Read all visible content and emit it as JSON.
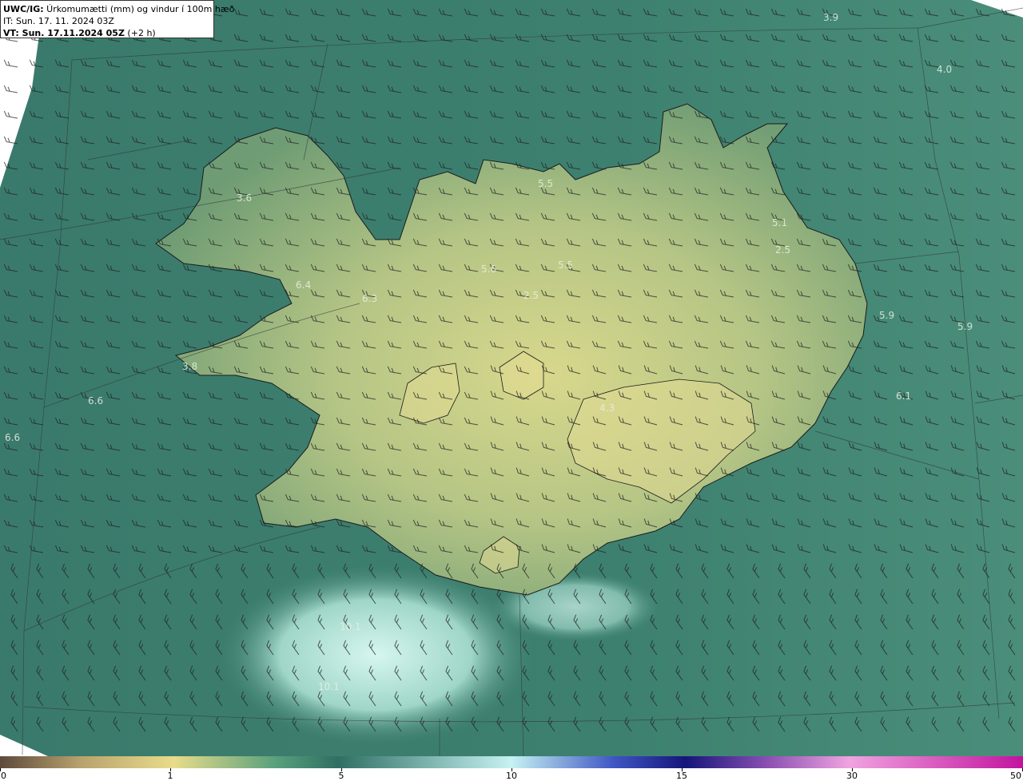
{
  "header": {
    "model_code": "UWC/IG:",
    "title_text": " Úrkomumætti (mm) og vindur í 100m hæð",
    "it_line": "IT: Sun. 17. 11. 2024 03Z",
    "vt_prefix": "VT: Sun. 17.11.2024 05Z",
    "vt_suffix": " (+2 h)"
  },
  "colorbar": {
    "tick_labels": [
      "0",
      "1",
      "5",
      "10",
      "15",
      "30",
      "50"
    ],
    "colors": {
      "low": "#5e4a3b",
      "mid_tan": "#b9a36e",
      "yellow": "#e8dc8a",
      "green": "#58a07c",
      "teal": "#2e6f63",
      "cyan_light": "#c6f2f2",
      "blue": "#3f56c4",
      "navy": "#15157a",
      "purple": "#8a4fb2",
      "pink": "#f0a3e0",
      "magenta": "#c2139f"
    }
  },
  "map": {
    "background_colors": {
      "sea": "#3d7e6e",
      "sea_dark": "#2c6256",
      "land_low": "#8fae78",
      "land_high": "#d6d68e",
      "precip_light": "#bde8e0"
    },
    "value_labels": [
      "3.9",
      "4.0",
      "3.6",
      "5.5",
      "5.1",
      "2.5",
      "5.6",
      "5.5",
      "6.4",
      "6.3",
      "2.5",
      "5.9",
      "5.9",
      "3.8",
      "6.1",
      "6.6",
      "6.6",
      "4.3",
      "10.1",
      "10.1"
    ],
    "icons": {
      "wind_barb": "wind-barb-icon",
      "info_marker": "map-marker-icon"
    }
  }
}
